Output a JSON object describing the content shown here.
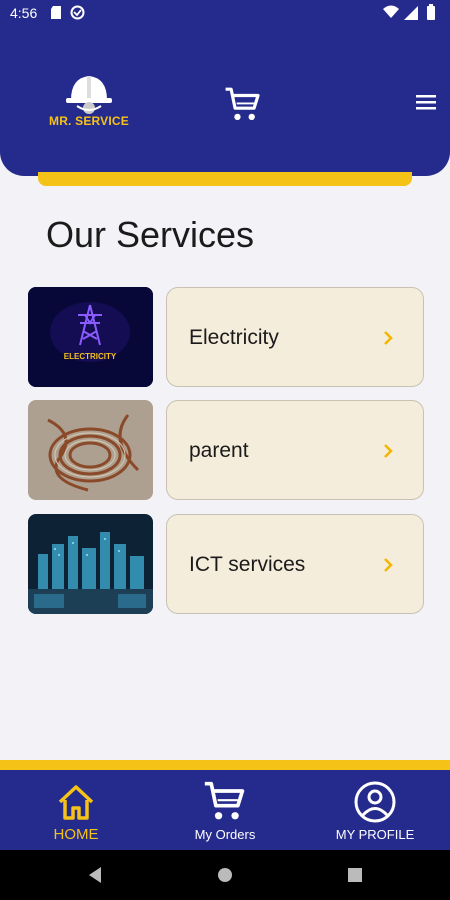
{
  "status_bar": {
    "time": "4:56"
  },
  "header": {
    "logo_text": "MR. SERVICE"
  },
  "page": {
    "title": "Our Services"
  },
  "services": [
    {
      "label": "Electricity",
      "image_caption": "ELECTRICITY"
    },
    {
      "label": "parent"
    },
    {
      "label": "ICT services"
    }
  ],
  "bottom_nav": {
    "items": [
      {
        "label": "HOME",
        "icon": "home-icon",
        "active": true
      },
      {
        "label": "My Orders",
        "icon": "cart-icon"
      },
      {
        "label": "MY PROFILE",
        "icon": "profile-icon"
      }
    ]
  },
  "colors": {
    "primary": "#252b8c",
    "accent": "#f5c218",
    "card": "#f5eddc"
  }
}
